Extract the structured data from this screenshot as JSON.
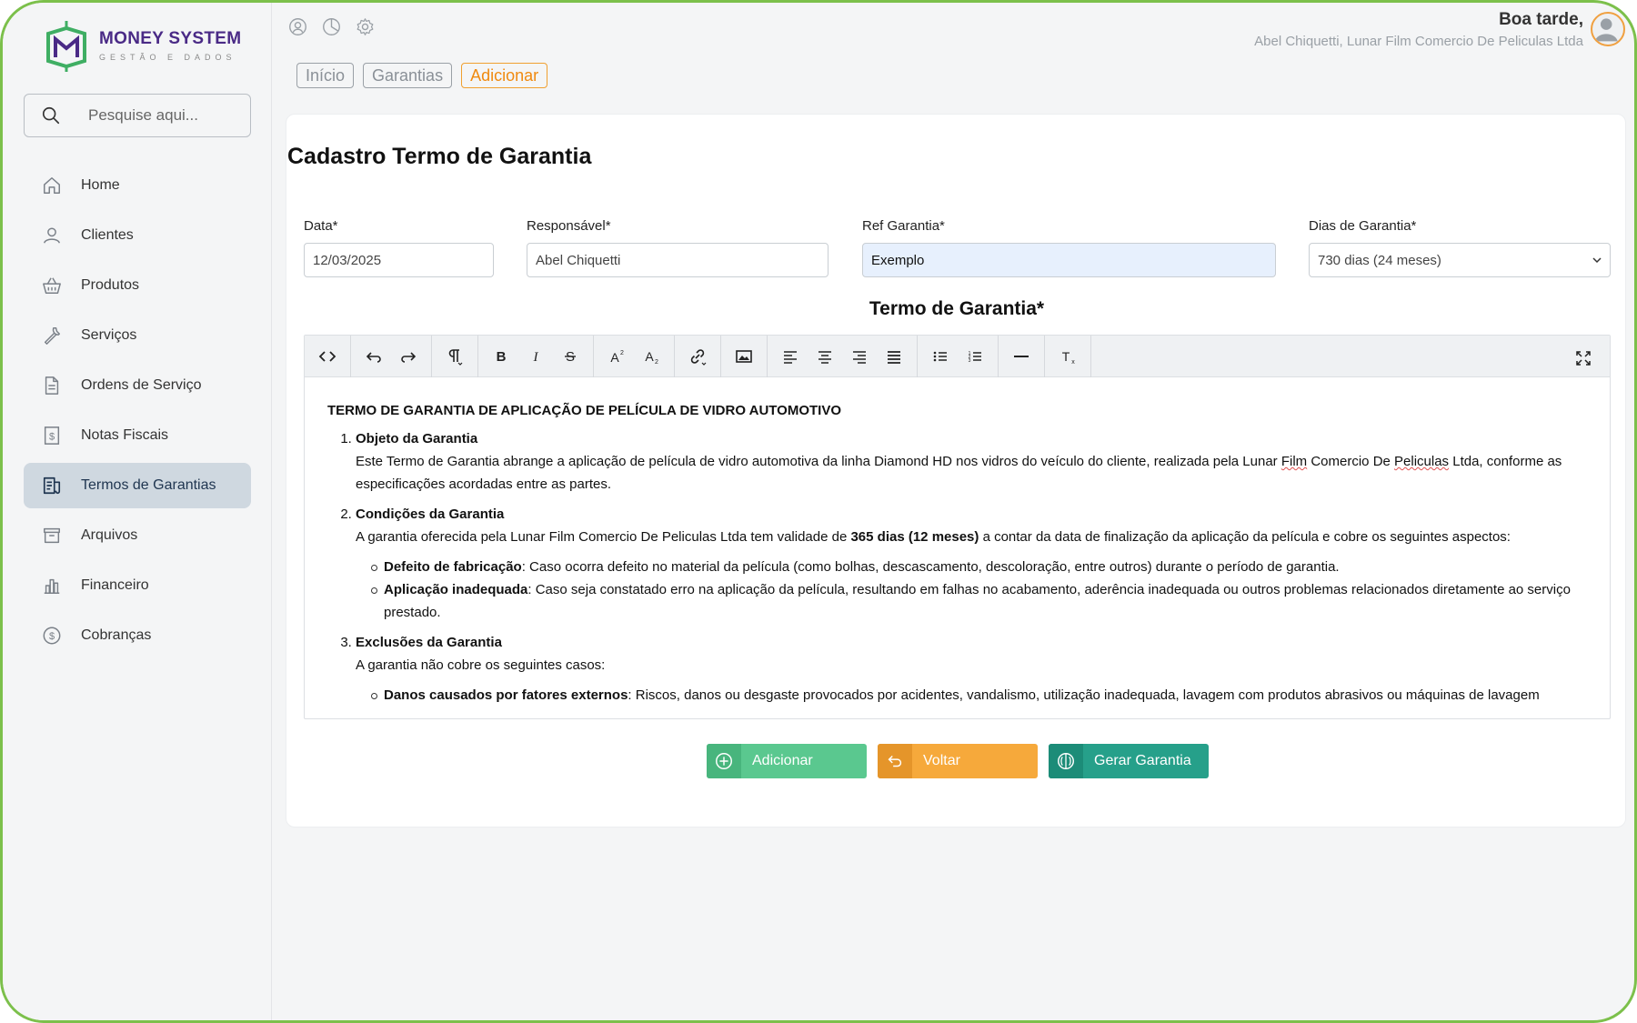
{
  "brand": {
    "title": "MONEY SYSTEM",
    "subtitle": "GESTÃO E DADOS",
    "primary_color": "#4a2a86",
    "accent_color": "#3fae63"
  },
  "search": {
    "placeholder": "Pesquise aqui..."
  },
  "sidebar": {
    "items": [
      {
        "label": "Home",
        "icon": "home-icon"
      },
      {
        "label": "Clientes",
        "icon": "user-icon"
      },
      {
        "label": "Produtos",
        "icon": "basket-icon"
      },
      {
        "label": "Serviços",
        "icon": "wrench-icon"
      },
      {
        "label": "Ordens de Serviço",
        "icon": "document-icon"
      },
      {
        "label": "Notas Fiscais",
        "icon": "invoice-icon"
      },
      {
        "label": "Termos de Garantias",
        "icon": "warranty-icon",
        "active": true
      },
      {
        "label": "Arquivos",
        "icon": "archive-icon"
      },
      {
        "label": "Financeiro",
        "icon": "chart-icon"
      },
      {
        "label": "Cobranças",
        "icon": "dollar-circle-icon"
      }
    ]
  },
  "header": {
    "greeting": "Boa tarde,",
    "user": "Abel Chiquetti, Lunar Film Comercio De Peliculas Ltda"
  },
  "breadcrumb": [
    "Início",
    "Garantias",
    "Adicionar"
  ],
  "form": {
    "title": "Cadastro Termo de Garantia",
    "data_label": "Data*",
    "data_value": "12/03/2025",
    "resp_label": "Responsável*",
    "resp_value": "Abel Chiquetti",
    "ref_label": "Ref Garantia*",
    "ref_value": "Exemplo",
    "dias_label": "Dias de Garantia*",
    "dias_value": "730 dias (24 meses)"
  },
  "editor": {
    "title": "Termo de Garantia*",
    "doc_title": "TERMO DE GARANTIA DE APLICAÇÃO DE PELÍCULA DE VIDRO AUTOMOTIVO",
    "s1_title": "Objeto da Garantia",
    "s1_text_a": "Este Termo de Garantia abrange a aplicação de película de vidro automotiva da linha Diamond HD nos vidros do veículo do cliente, realizada pela Lunar ",
    "s1_film": "Film",
    "s1_text_b": " Comercio De ",
    "s1_peliculas": "Peliculas",
    "s1_text_c": " Ltda, conforme as especificações acordadas entre as partes.",
    "s2_title": "Condições da Garantia",
    "s2_text_a": "A garantia oferecida pela Lunar Film Comercio De Peliculas Ltda tem validade de ",
    "s2_bold": "365 dias (12 meses)",
    "s2_text_b": " a contar da data de finalização da aplicação da película e cobre os seguintes aspectos:",
    "s2_b1_title": "Defeito de fabricação",
    "s2_b1_text": ": Caso ocorra defeito no material da película (como bolhas, descascamento, descoloração, entre outros) durante o período de garantia.",
    "s2_b2_title": "Aplicação inadequada",
    "s2_b2_text": ": Caso seja constatado erro na aplicação da película, resultando em falhas no acabamento, aderência inadequada ou outros problemas relacionados diretamente ao serviço prestado.",
    "s3_title": "Exclusões da Garantia",
    "s3_text": "A garantia não cobre os seguintes casos:",
    "s3_b1_title": "Danos causados por fatores externos",
    "s3_b1_text": ": Riscos, danos ou desgaste provocados por acidentes, vandalismo, utilização inadequada, lavagem com produtos abrasivos ou máquinas de lavagem"
  },
  "actions": {
    "add": "Adicionar",
    "back": "Voltar",
    "generate": "Gerar Garantia"
  },
  "colors": {
    "add": "#5ac88f",
    "back": "#f6a93b",
    "generate": "#26a08a",
    "active_nav": "#cfd8e0",
    "frame": "#7cc04b"
  }
}
